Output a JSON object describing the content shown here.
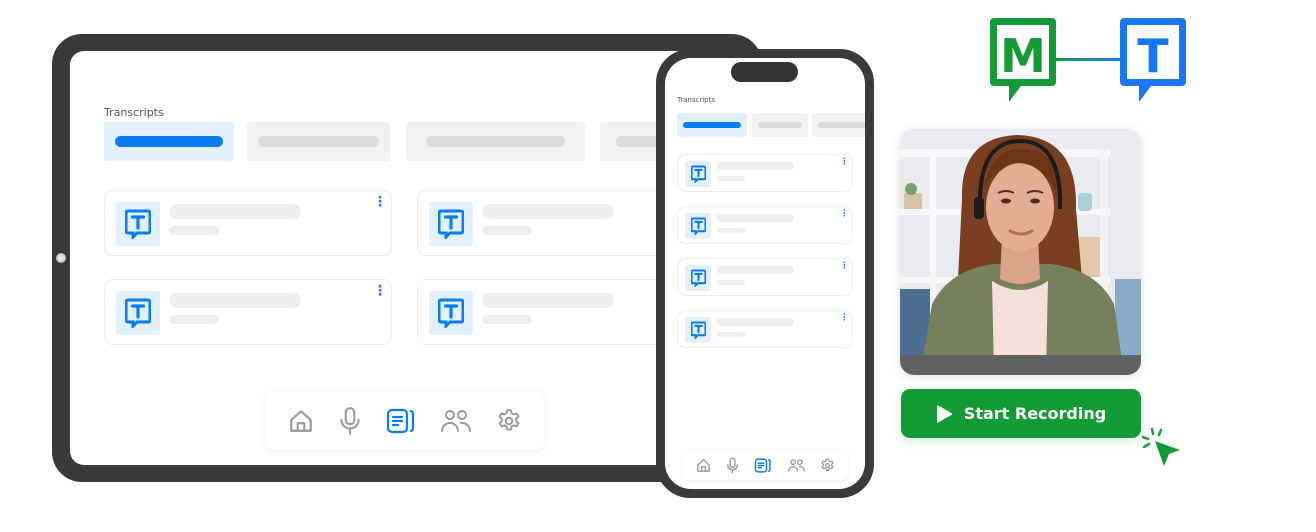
{
  "tablet": {
    "screen_title": "Transcripts",
    "tabs": [
      {
        "name": "tab-1",
        "active": true
      },
      {
        "name": "tab-2",
        "active": false
      },
      {
        "name": "tab-3",
        "active": false
      },
      {
        "name": "tab-4",
        "active": false
      }
    ],
    "cards": [
      {
        "icon": "transcript-t-icon",
        "menu": "more-vert-icon"
      },
      {
        "icon": "transcript-t-icon",
        "menu": "more-vert-icon"
      },
      {
        "icon": "transcript-t-icon",
        "menu": "more-vert-icon"
      },
      {
        "icon": "transcript-t-icon",
        "menu": "more-vert-icon"
      }
    ],
    "nav": [
      {
        "name": "home",
        "icon": "home-icon",
        "active": false
      },
      {
        "name": "record",
        "icon": "microphone-icon",
        "active": false
      },
      {
        "name": "transcripts",
        "icon": "transcripts-icon",
        "active": true
      },
      {
        "name": "contacts",
        "icon": "people-icon",
        "active": false
      },
      {
        "name": "settings",
        "icon": "gear-icon",
        "active": false
      }
    ]
  },
  "phone": {
    "screen_title": "Transcripts",
    "cards_count": 4,
    "nav": [
      {
        "name": "home",
        "icon": "home-icon",
        "active": false
      },
      {
        "name": "record",
        "icon": "microphone-icon",
        "active": false
      },
      {
        "name": "transcripts",
        "icon": "transcripts-icon",
        "active": true
      },
      {
        "name": "contacts",
        "icon": "people-icon",
        "active": false
      },
      {
        "name": "settings",
        "icon": "gear-icon",
        "active": false
      }
    ]
  },
  "logo": {
    "left_letter": "M",
    "right_letter": "T"
  },
  "cta": {
    "label": "Start Recording",
    "icon": "play-icon"
  },
  "photo": {
    "alt": "Woman wearing headset smiling at camera"
  },
  "colors": {
    "brand_blue": "#0A7CF4",
    "brand_green": "#149A37",
    "device_frame": "#3A3A3A",
    "skeleton": "#EEEEEE",
    "active_tab_bg": "#E3F0FD",
    "nav_inactive": "#9A9A9A"
  }
}
